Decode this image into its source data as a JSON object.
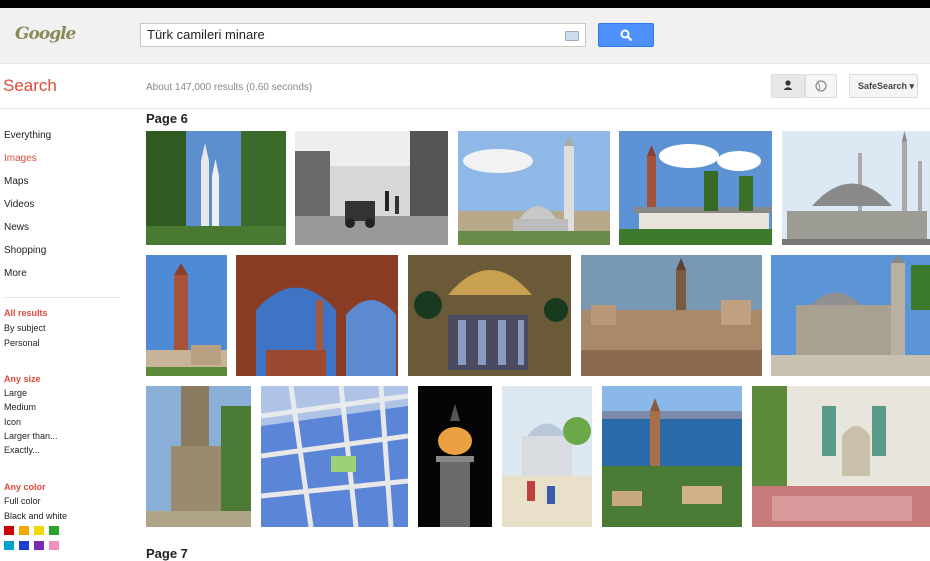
{
  "header": {
    "logo_text": "Google",
    "query": "Türk camileri minare"
  },
  "subbar": {
    "search_label": "Search",
    "results_stats": "About 147,000 results (0.60 seconds)",
    "safesearch_label": "SafeSearch ▾"
  },
  "nav": {
    "items": [
      "Everything",
      "Images",
      "Maps",
      "Videos",
      "News",
      "Shopping",
      "More"
    ],
    "active": "Images"
  },
  "filters": {
    "results": {
      "heading": "All results",
      "options": [
        "By subject",
        "Personal"
      ]
    },
    "size": {
      "heading": "Any size",
      "options": [
        "Large",
        "Medium",
        "Icon",
        "Larger than...",
        "Exactly..."
      ]
    },
    "color": {
      "heading": "Any color",
      "options": [
        "Full color",
        "Black and white"
      ]
    },
    "swatches": [
      "#cc0000",
      "#f6a800",
      "#f0d800",
      "#2aa52a",
      "#00a0d0",
      "#1a3fd0",
      "#7a2ab0",
      "#f090c0"
    ]
  },
  "pages": {
    "page6": "Page 6",
    "page7": "Page 7"
  },
  "images": {
    "row1": [
      "mosque-minarets-trees",
      "old-street-photo-bw",
      "mosque-with-tall-minaret",
      "mosque-garden-minaret",
      "large-domed-mosque"
    ],
    "row2": [
      "brick-minaret-tower",
      "arched-ruins-minaret",
      "hagia-sophia-interior",
      "city-view-minaret",
      "stone-mosque-minaret"
    ],
    "row3": [
      "ruined-minaret-street",
      "street-map",
      "lit-minaret-night",
      "painted-mosque-scene",
      "antalya-yivli-minaret",
      "mosque-interior-carpet"
    ]
  }
}
